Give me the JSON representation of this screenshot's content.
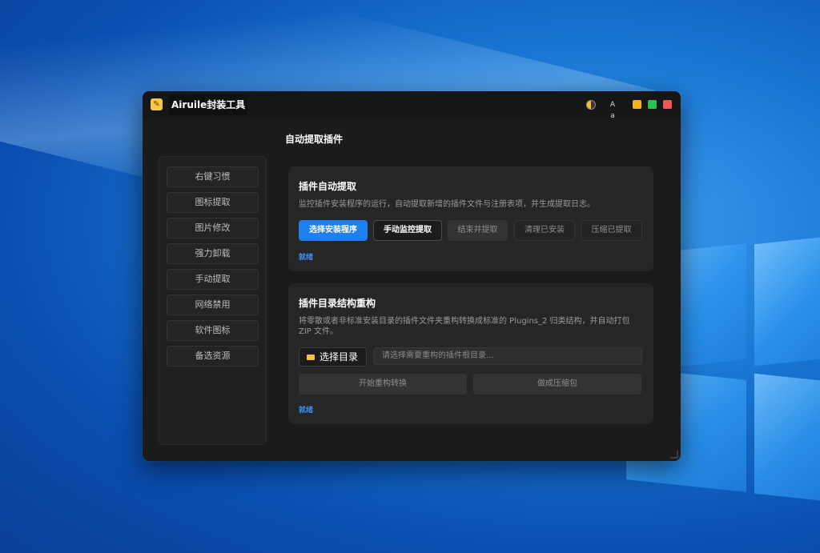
{
  "window": {
    "title": "Airuile封装工具",
    "lang_icon_text": "A a"
  },
  "sidebar": {
    "items": [
      {
        "label": "右键习惯"
      },
      {
        "label": "图标提取"
      },
      {
        "label": "图片修改"
      },
      {
        "label": "强力卸载"
      },
      {
        "label": "手动提取"
      },
      {
        "label": "网络禁用"
      },
      {
        "label": "软件图标"
      },
      {
        "label": "备选资源"
      }
    ]
  },
  "main": {
    "page_title": "自动提取插件",
    "auto_extract": {
      "title": "插件自动提取",
      "description": "监控插件安装程序的运行，自动提取新增的插件文件与注册表项，并生成提取日志。",
      "buttons": {
        "select_installer": "选择安装程序",
        "manual_monitor": "手动监控提取",
        "stop_extract": "结束并提取",
        "clean_installed": "清理已安装",
        "compress_extracted": "压缩已提取"
      },
      "status": "就绪"
    },
    "restructure": {
      "title": "插件目录结构重构",
      "description": "将零散或者非标准安装目录的插件文件夹重构转换成标准的 Plugins_2 归类结构，并自动打包 ZIP 文件。",
      "select_dir_label": "选择目录",
      "dir_placeholder": "请选择需要重构的插件根目录...",
      "buttons": {
        "start_convert": "开始重构转换",
        "make_package": "做成压缩包"
      },
      "status": "就绪"
    }
  },
  "colors": {
    "accent": "#1e7ff0",
    "status": "#3d8ef0",
    "minimize": "#f4b324",
    "maximize": "#27c44e",
    "close": "#f25757"
  }
}
